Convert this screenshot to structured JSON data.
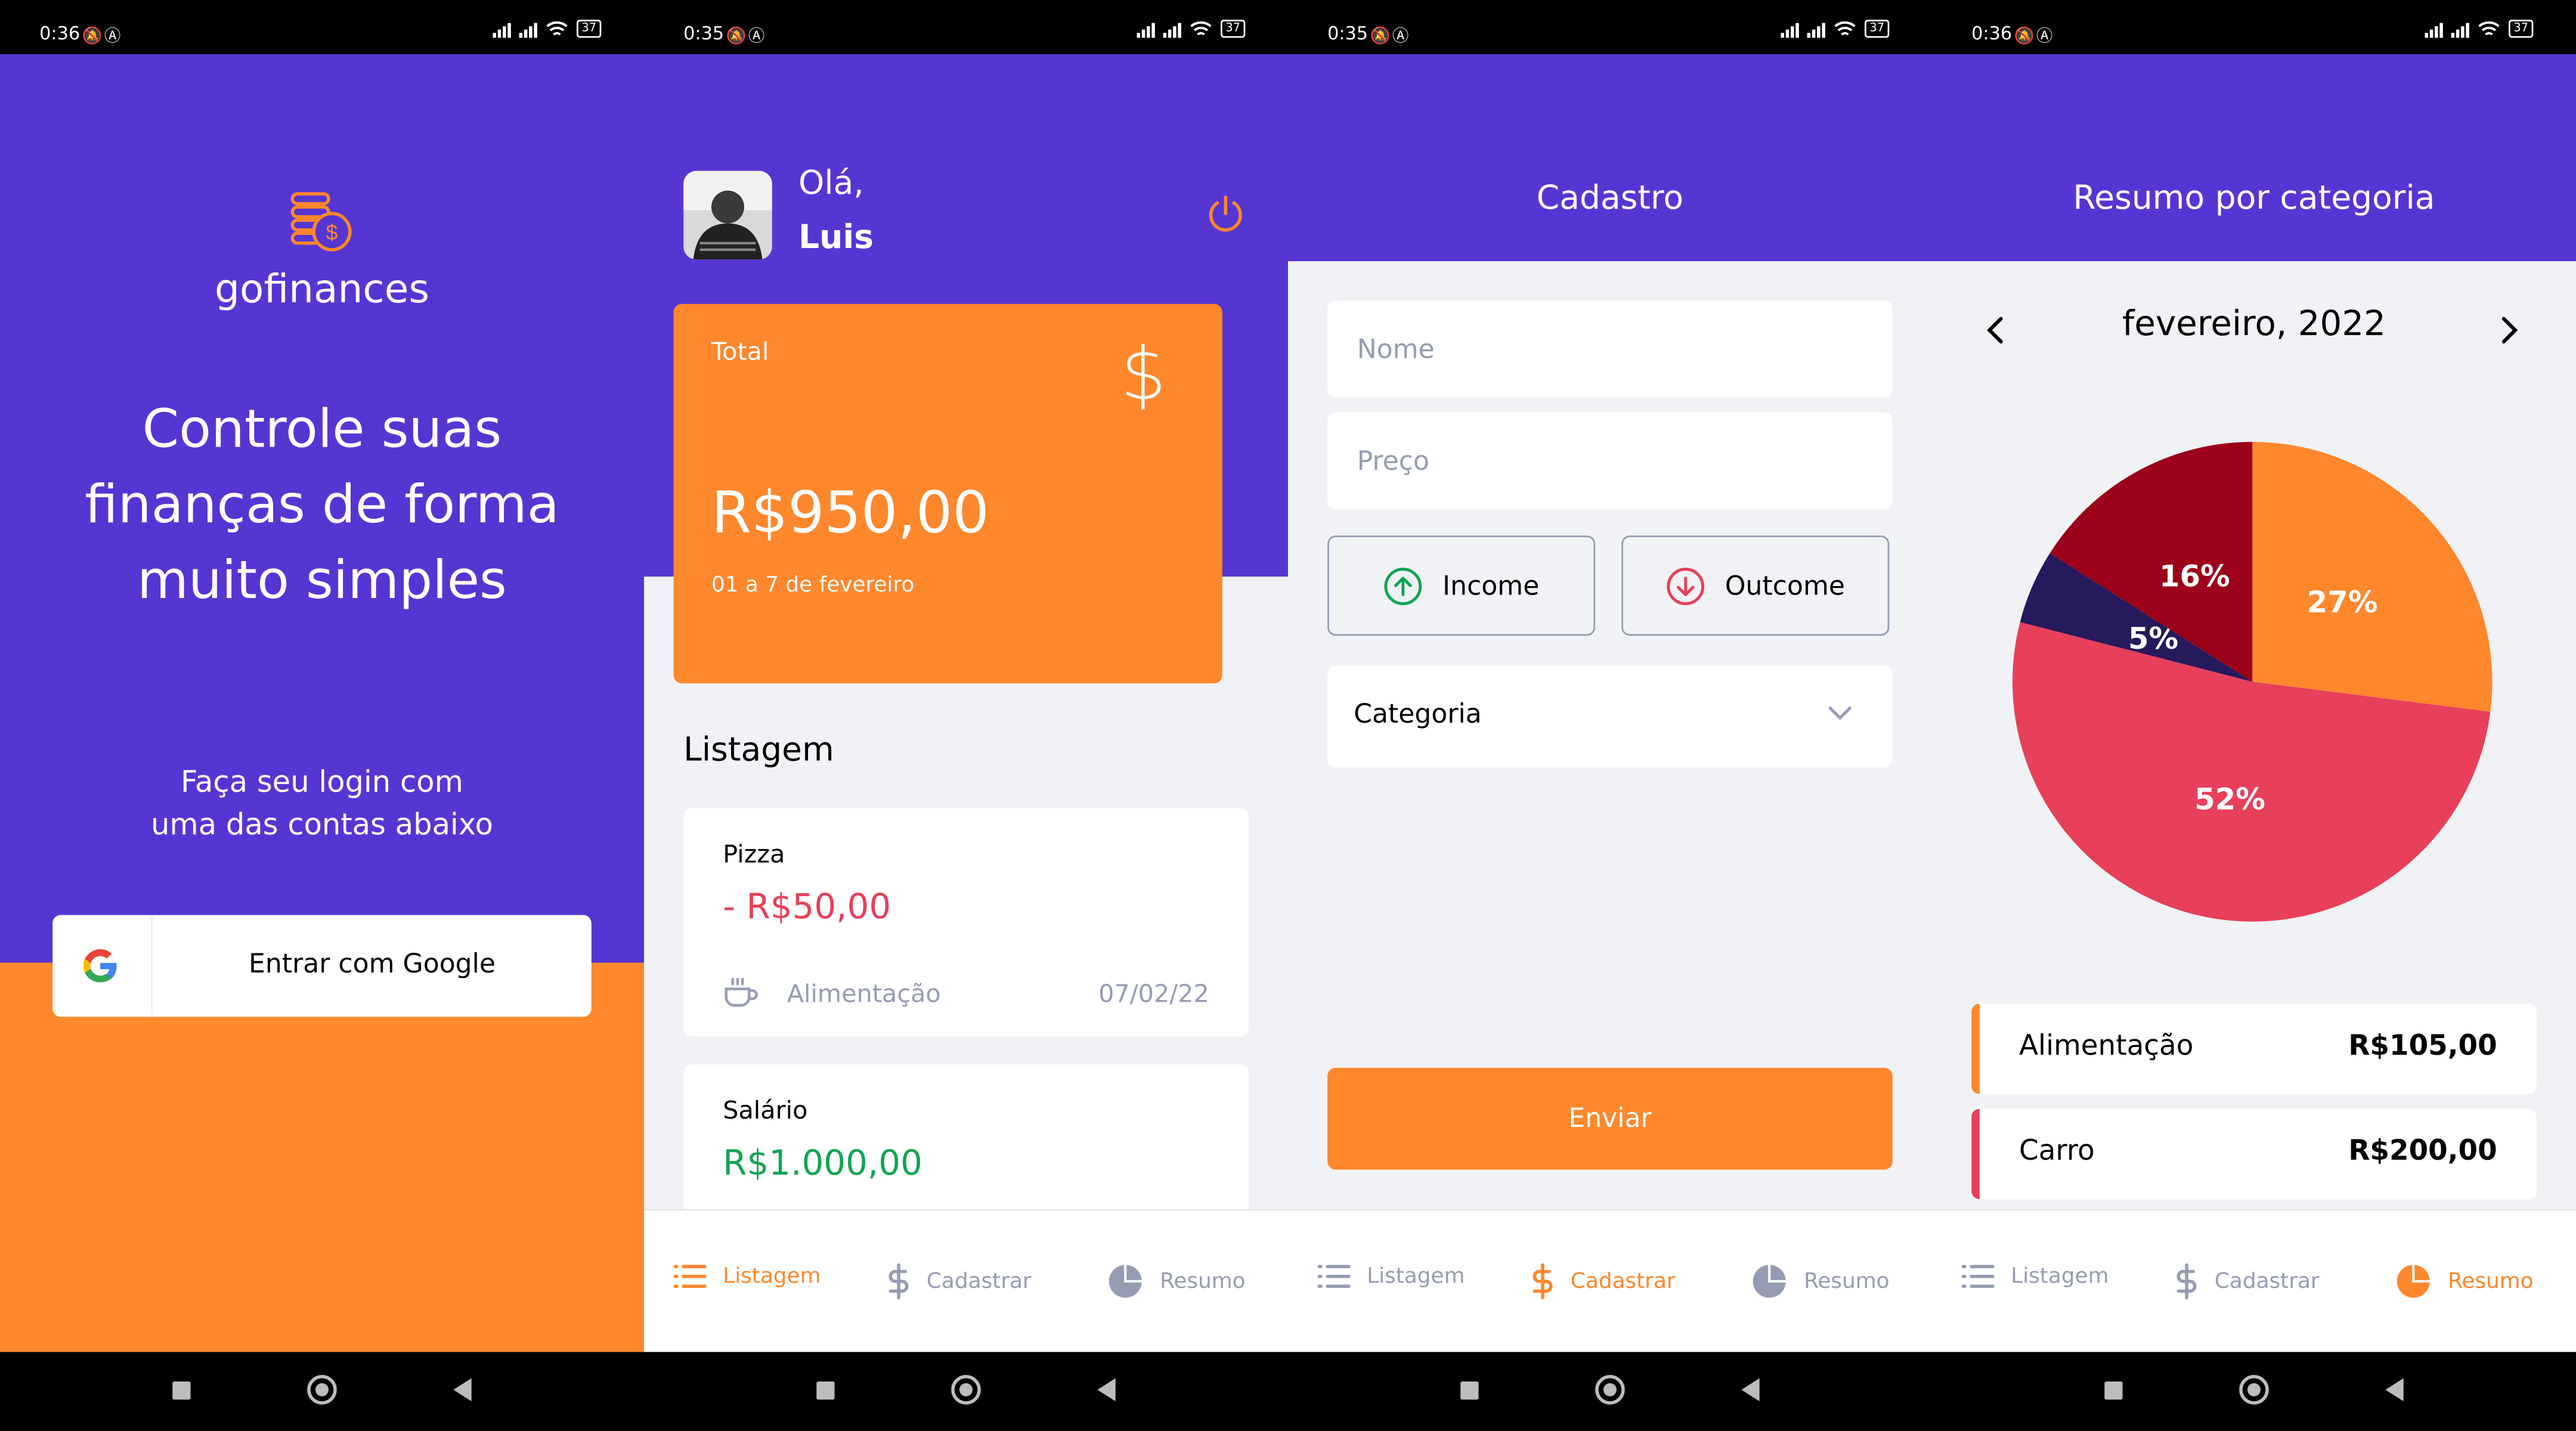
{
  "colors": {
    "primary": "#5636D3",
    "secondary": "#FF872C",
    "success": "#12A454",
    "attention": "#E83F5B",
    "text_light": "#969CB2",
    "background": "#F0F2F5"
  },
  "status_bars": [
    {
      "time": "0:36"
    },
    {
      "time": "0:35"
    },
    {
      "time": "0:35"
    },
    {
      "time": "0:36"
    }
  ],
  "battery": "37",
  "tabs": {
    "listagem": "Listagem",
    "cadastrar": "Cadastrar",
    "resumo": "Resumo"
  },
  "signin": {
    "app_name": "gofinances",
    "headline_lines": [
      "Controle suas",
      "finanças de forma",
      "muito simples"
    ],
    "subtitle_lines": [
      "Faça seu login com",
      "uma das contas abaixo"
    ],
    "google_button": "Entrar com Google"
  },
  "dashboard": {
    "greeting": "Olá,",
    "user_name": "Luis",
    "total_card": {
      "title": "Total",
      "amount": "R$950,00",
      "period": "01 a 7 de fevereiro",
      "icon": "dollar-sign"
    },
    "list_title": "Listagem",
    "transactions": [
      {
        "title": "Pizza",
        "amount": "- R$50,00",
        "type": "outcome",
        "category": "Alimentação",
        "category_icon": "coffee",
        "date": "07/02/22"
      },
      {
        "title": "Salário",
        "amount": "R$1.000,00",
        "type": "income"
      }
    ]
  },
  "register": {
    "title": "Cadastro",
    "name_placeholder": "Nome",
    "price_placeholder": "Preço",
    "income_label": "Income",
    "outcome_label": "Outcome",
    "category_label": "Categoria",
    "submit_label": "Enviar"
  },
  "resume": {
    "title": "Resumo por categoria",
    "month": "fevereiro, 2022",
    "categories": [
      {
        "name": "Alimentação",
        "amount": "R$105,00",
        "color": "#FF872C"
      },
      {
        "name": "Carro",
        "amount": "R$200,00",
        "color": "#E83F5B"
      }
    ]
  },
  "chart_data": {
    "type": "pie",
    "slices": [
      {
        "label": "27%",
        "value": 27,
        "color": "#FF872C"
      },
      {
        "label": "52%",
        "value": 52,
        "color": "#E83F5B"
      },
      {
        "label": "5%",
        "value": 5,
        "color": "#26195C"
      },
      {
        "label": "16%",
        "value": 16,
        "color": "#9C001A"
      }
    ]
  }
}
